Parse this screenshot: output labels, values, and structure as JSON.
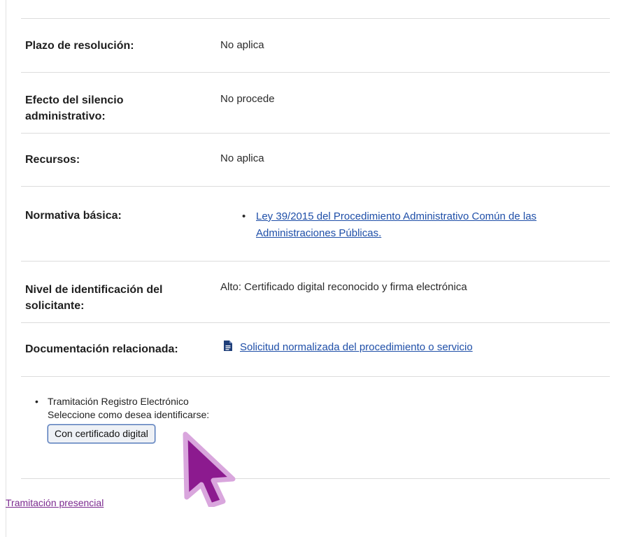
{
  "rows": {
    "plazo": {
      "label": "Plazo de resolución:",
      "value": "No aplica"
    },
    "silencio": {
      "label_line1": "Efecto del silencio",
      "label_line2": "administrativo:",
      "value": "No procede"
    },
    "recursos": {
      "label": "Recursos:",
      "value": "No aplica"
    },
    "normativa": {
      "label": "Normativa básica:",
      "items": [
        {
          "line1": "Ley 39/2015 del Procedimiento Administrativo Común de las",
          "line2": "Administraciones Públicas."
        }
      ]
    },
    "identificacion": {
      "label_line1": "Nivel de identificación del",
      "label_line2": "solicitante:",
      "value": "Alto: Certificado digital reconocido y firma electrónica"
    },
    "documentacion": {
      "label": "Documentación relacionada:",
      "link_text": "Solicitud normalizada del procedimiento o servicio",
      "icon": "document-icon"
    }
  },
  "tramitacion": {
    "item_title": "Tramitación Registro Electrónico",
    "prompt": "Seleccione como desea identificarse:",
    "button_label": "Con certificado digital"
  },
  "footer_link": "Tramitación presencial",
  "colors": {
    "link": "#1f4fa8",
    "visited_link": "#7b2a8f",
    "pointer_fill": "#8c1a8f",
    "pointer_glow": "#d9a6dd"
  }
}
